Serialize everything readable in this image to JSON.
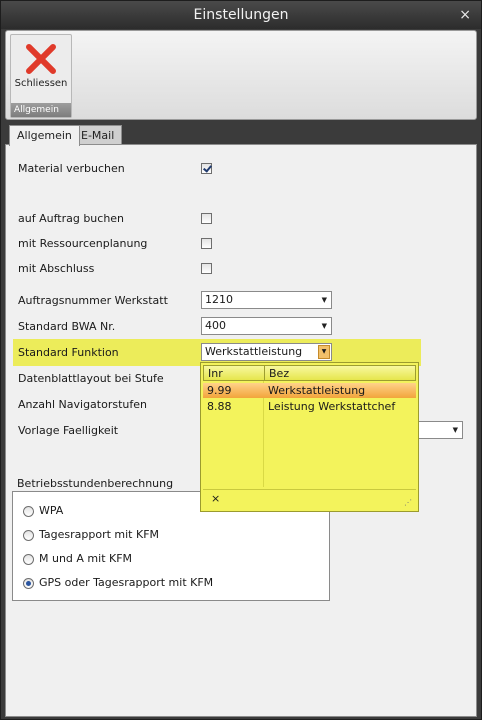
{
  "window": {
    "title": "Einstellungen",
    "close_glyph": "×"
  },
  "ribbon": {
    "close_button_label": "Schliessen",
    "group_label": "Allgemein",
    "close_icon": "red-x-icon"
  },
  "tabs": [
    {
      "label": "Allgemein",
      "active": true
    },
    {
      "label": "E-Mail",
      "active": false
    }
  ],
  "form": {
    "material_verbuchen": {
      "label": "Material verbuchen",
      "checked": true
    },
    "auf_auftrag_buchen": {
      "label": "auf Auftrag buchen",
      "checked": false
    },
    "mit_ressourcenplanung": {
      "label": "mit Ressourcenplanung",
      "checked": false
    },
    "mit_abschluss": {
      "label": "mit Abschluss",
      "checked": false
    },
    "auftragsnummer_werkstatt": {
      "label": "Auftragsnummer Werkstatt",
      "value": "1210"
    },
    "standard_bwa": {
      "label": "Standard BWA Nr.",
      "value": "400"
    },
    "standard_funktion": {
      "label": "Standard Funktion",
      "value": "Werkstattleistung"
    },
    "datenblattlayout": {
      "label": "Datenblattlayout bei Stufe"
    },
    "anzahl_navigatorstufen": {
      "label": "Anzahl Navigatorstufen"
    },
    "vorlage_faelligkeit": {
      "label": "Vorlage Faelligkeit"
    }
  },
  "popup": {
    "columns": [
      "Inr",
      "Bez"
    ],
    "rows": [
      {
        "inr": "9.99",
        "bez": "Werkstattleistung",
        "selected": true
      },
      {
        "inr": "8.88",
        "bez": "Leistung Werkstattchef",
        "selected": false
      }
    ],
    "clear_glyph": "×",
    "grip_glyph": "⋰"
  },
  "betriebsstunden": {
    "title": "Betriebsstundenberechnung",
    "options": [
      {
        "label": "WPA",
        "selected": false
      },
      {
        "label": "Tagesrapport mit KFM",
        "selected": false
      },
      {
        "label": "M und A mit KFM",
        "selected": false
      },
      {
        "label": "GPS oder Tagesrapport mit KFM",
        "selected": true
      }
    ]
  },
  "colors": {
    "highlight": "#ecec5a",
    "selected_row": "#f2a43b",
    "title_bar": "#3b3b3b"
  }
}
